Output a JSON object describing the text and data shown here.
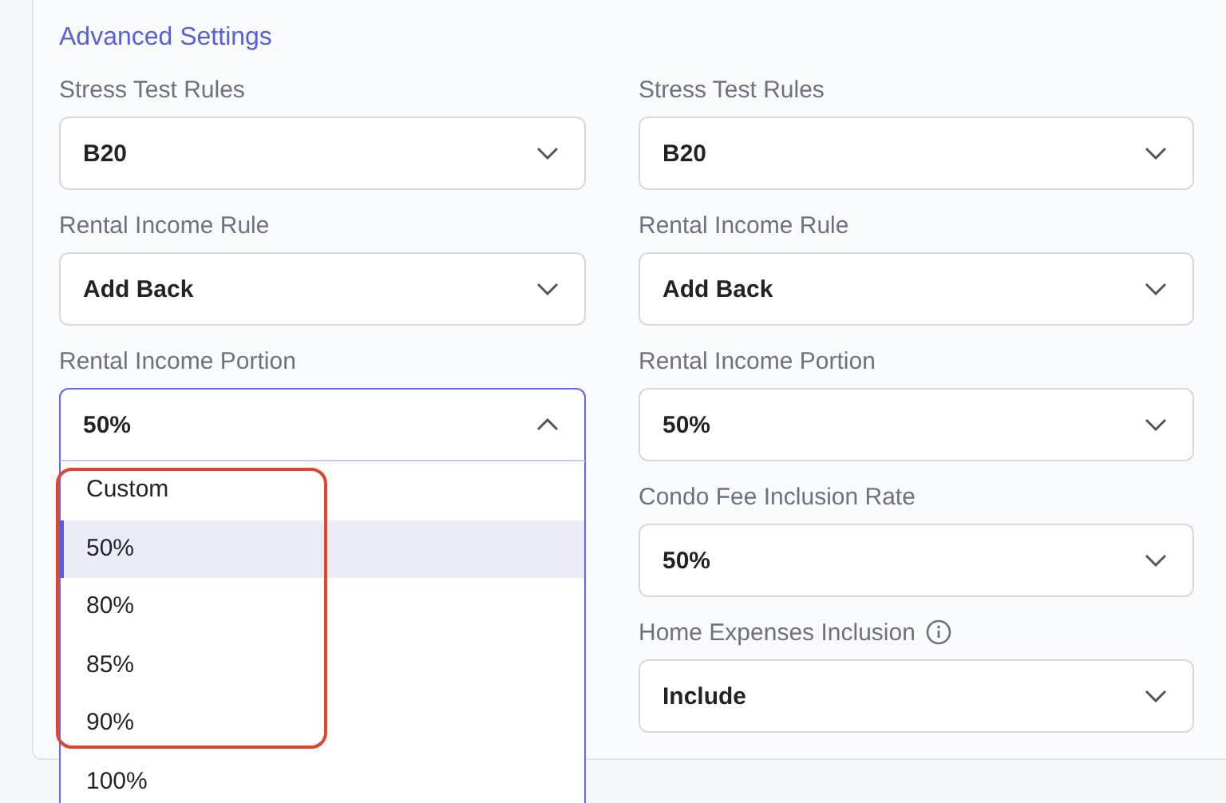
{
  "section": {
    "title": "Advanced Settings"
  },
  "columns": [
    {
      "fields": [
        {
          "label": "Stress Test Rules",
          "value": "B20",
          "open": false
        },
        {
          "label": "Rental Income Rule",
          "value": "Add Back",
          "open": false
        },
        {
          "label": "Rental Income Portion",
          "value": "50%",
          "open": true,
          "options": [
            {
              "label": "Custom",
              "selected": false
            },
            {
              "label": "50%",
              "selected": true
            },
            {
              "label": "80%",
              "selected": false
            },
            {
              "label": "85%",
              "selected": false
            },
            {
              "label": "90%",
              "selected": false
            },
            {
              "label": "100%",
              "selected": false
            }
          ]
        }
      ]
    },
    {
      "fields": [
        {
          "label": "Stress Test Rules",
          "value": "B20",
          "open": false
        },
        {
          "label": "Rental Income Rule",
          "value": "Add Back",
          "open": false
        },
        {
          "label": "Rental Income Portion",
          "value": "50%",
          "open": false
        },
        {
          "label": "Condo Fee Inclusion Rate",
          "value": "50%",
          "open": false
        },
        {
          "label": "Home Expenses Inclusion",
          "value": "Include",
          "open": false,
          "info": true
        }
      ]
    }
  ]
}
